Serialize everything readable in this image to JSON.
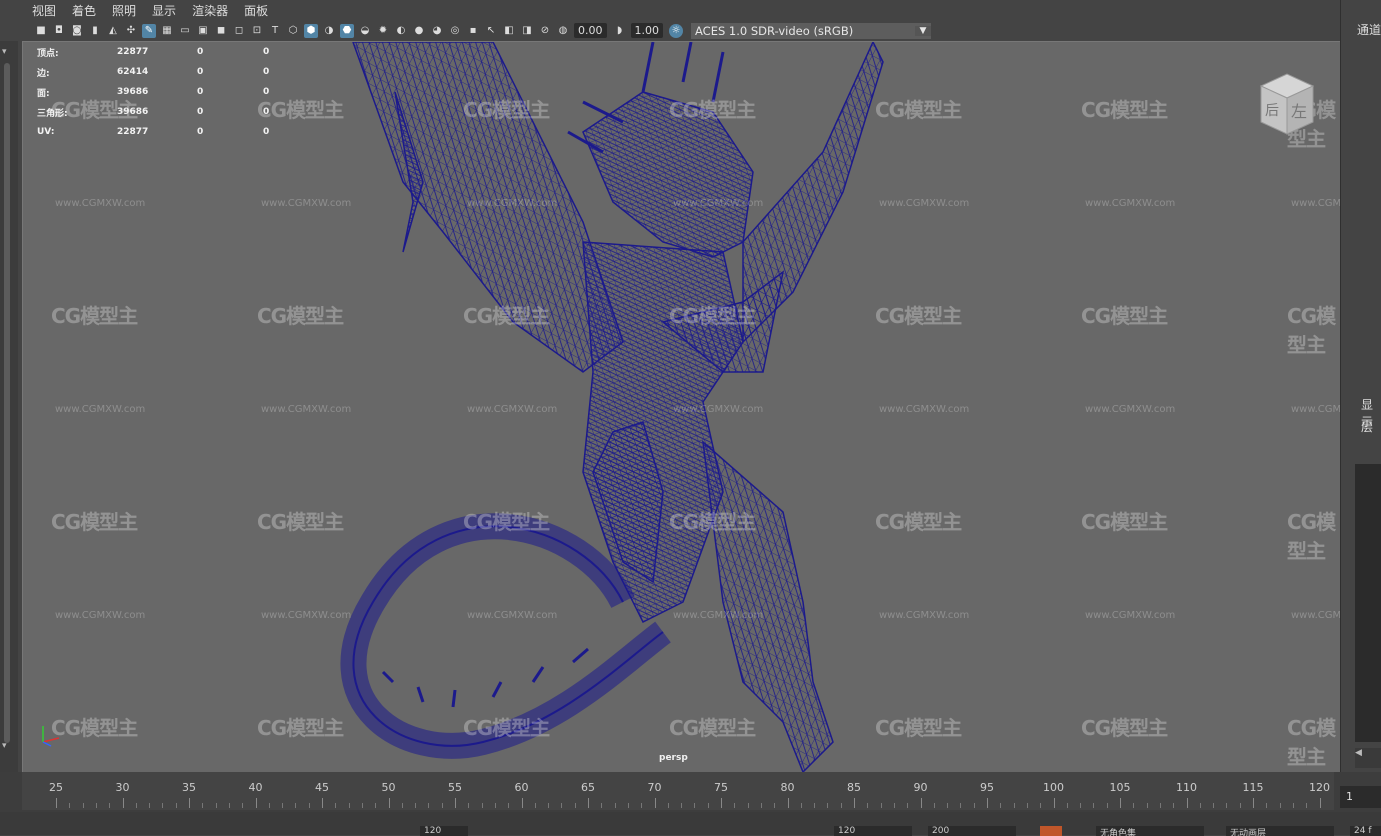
{
  "menu": [
    "视图",
    "着色",
    "照明",
    "显示",
    "渲染器",
    "面板"
  ],
  "toolbar": {
    "exposure_value": "0.00",
    "gamma_value": "1.00",
    "color_space_label": "ACES 1.0 SDR-video (sRGB)"
  },
  "hud": {
    "rows": [
      {
        "label": "顶点:",
        "v1": "22877",
        "v2": "0",
        "v3": "0"
      },
      {
        "label": "边:",
        "v1": "62414",
        "v2": "0",
        "v3": "0"
      },
      {
        "label": "面:",
        "v1": "39686",
        "v2": "0",
        "v3": "0"
      },
      {
        "label": "三角形:",
        "v1": "39686",
        "v2": "0",
        "v3": "0"
      },
      {
        "label": "UV:",
        "v1": "22877",
        "v2": "0",
        "v3": "0"
      }
    ]
  },
  "view_cube": {
    "face_back": "后",
    "face_left": "左"
  },
  "camera_name": "persp",
  "watermark": {
    "logo": "CG模型主",
    "url": "www.CGMXW.com"
  },
  "right_panel": {
    "channel_label": "通道",
    "display_label": "显示",
    "layer_label": "层"
  },
  "timeline": {
    "ticks": [
      "25",
      "30",
      "35",
      "40",
      "45",
      "50",
      "55",
      "60",
      "65",
      "70",
      "75",
      "80",
      "85",
      "90",
      "95",
      "100",
      "105",
      "110",
      "115",
      "120"
    ],
    "current_frame": "1"
  },
  "range_bar": {
    "start_val": "120",
    "end_a": "120",
    "end_b": "200",
    "char_set": "无角色集",
    "anim_layer": "无动画层",
    "fps_partial": "24 f"
  },
  "colors": {
    "viewport_bg": "#686868",
    "ui_bg": "#444444",
    "wireframe": "#1c1a8c",
    "active_icon": "#5285a6"
  }
}
